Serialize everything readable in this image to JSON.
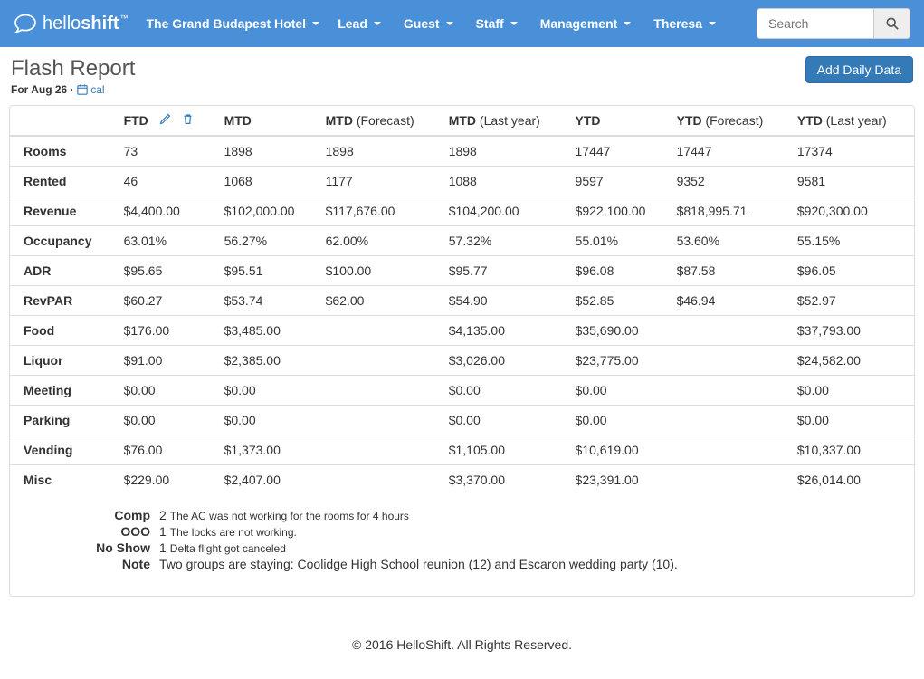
{
  "navbar": {
    "brand_prefix": "hello",
    "brand_suffix": "shift",
    "hotel": "The Grand Budapest Hotel",
    "menu": [
      "Lead",
      "Guest",
      "Staff",
      "Management",
      "Theresa"
    ],
    "search_placeholder": "Search"
  },
  "header": {
    "title": "Flash Report",
    "subtitle_prefix": "For Aug 26 · ",
    "cal_label": "cal",
    "add_button": "Add Daily Data"
  },
  "columns": [
    {
      "label": "FTD",
      "sub": ""
    },
    {
      "label": "MTD",
      "sub": ""
    },
    {
      "label": "MTD",
      "sub": "(Forecast)"
    },
    {
      "label": "MTD",
      "sub": "(Last year)"
    },
    {
      "label": "YTD",
      "sub": ""
    },
    {
      "label": "YTD",
      "sub": "(Forecast)"
    },
    {
      "label": "YTD",
      "sub": "(Last year)"
    }
  ],
  "rows": [
    {
      "label": "Rooms",
      "values": [
        "73",
        "1898",
        "1898",
        "1898",
        "17447",
        "17447",
        "17374"
      ]
    },
    {
      "label": "Rented",
      "values": [
        "46",
        "1068",
        "1177",
        "1088",
        "9597",
        "9352",
        "9581"
      ]
    },
    {
      "label": "Revenue",
      "values": [
        "$4,400.00",
        "$102,000.00",
        "$117,676.00",
        "$104,200.00",
        "$922,100.00",
        "$818,995.71",
        "$920,300.00"
      ]
    },
    {
      "label": "Occupancy",
      "values": [
        "63.01%",
        "56.27%",
        "62.00%",
        "57.32%",
        "55.01%",
        "53.60%",
        "55.15%"
      ]
    },
    {
      "label": "ADR",
      "values": [
        "$95.65",
        "$95.51",
        "$100.00",
        "$95.77",
        "$96.08",
        "$87.58",
        "$96.05"
      ]
    },
    {
      "label": "RevPAR",
      "values": [
        "$60.27",
        "$53.74",
        "$62.00",
        "$54.90",
        "$52.85",
        "$46.94",
        "$52.97"
      ]
    },
    {
      "label": "Food",
      "values": [
        "$176.00",
        "$3,485.00",
        "",
        "$4,135.00",
        "$35,690.00",
        "",
        "$37,793.00"
      ]
    },
    {
      "label": "Liquor",
      "values": [
        "$91.00",
        "$2,385.00",
        "",
        "$3,026.00",
        "$23,775.00",
        "",
        "$24,582.00"
      ]
    },
    {
      "label": "Meeting",
      "values": [
        "$0.00",
        "$0.00",
        "",
        "$0.00",
        "$0.00",
        "",
        "$0.00"
      ]
    },
    {
      "label": "Parking",
      "values": [
        "$0.00",
        "$0.00",
        "",
        "$0.00",
        "$0.00",
        "",
        "$0.00"
      ]
    },
    {
      "label": "Vending",
      "values": [
        "$76.00",
        "$1,373.00",
        "",
        "$1,105.00",
        "$10,619.00",
        "",
        "$10,337.00"
      ]
    },
    {
      "label": "Misc",
      "values": [
        "$229.00",
        "$2,407.00",
        "",
        "$3,370.00",
        "$23,391.00",
        "",
        "$26,014.00"
      ]
    }
  ],
  "notes": {
    "comp": {
      "label": "Comp",
      "count": "2",
      "text": "The AC was not working for the rooms for 4 hours"
    },
    "ooo": {
      "label": "OOO",
      "count": "1",
      "text": "The locks are not working."
    },
    "noshow": {
      "label": "No Show",
      "count": "1",
      "text": "Delta flight got canceled"
    },
    "note": {
      "label": "Note",
      "count": "",
      "text": "Two groups are staying: Coolidge High School reunion (12) and Escaron wedding party (10)."
    }
  },
  "footer": "© 2016 HelloShift. All Rights Reserved."
}
